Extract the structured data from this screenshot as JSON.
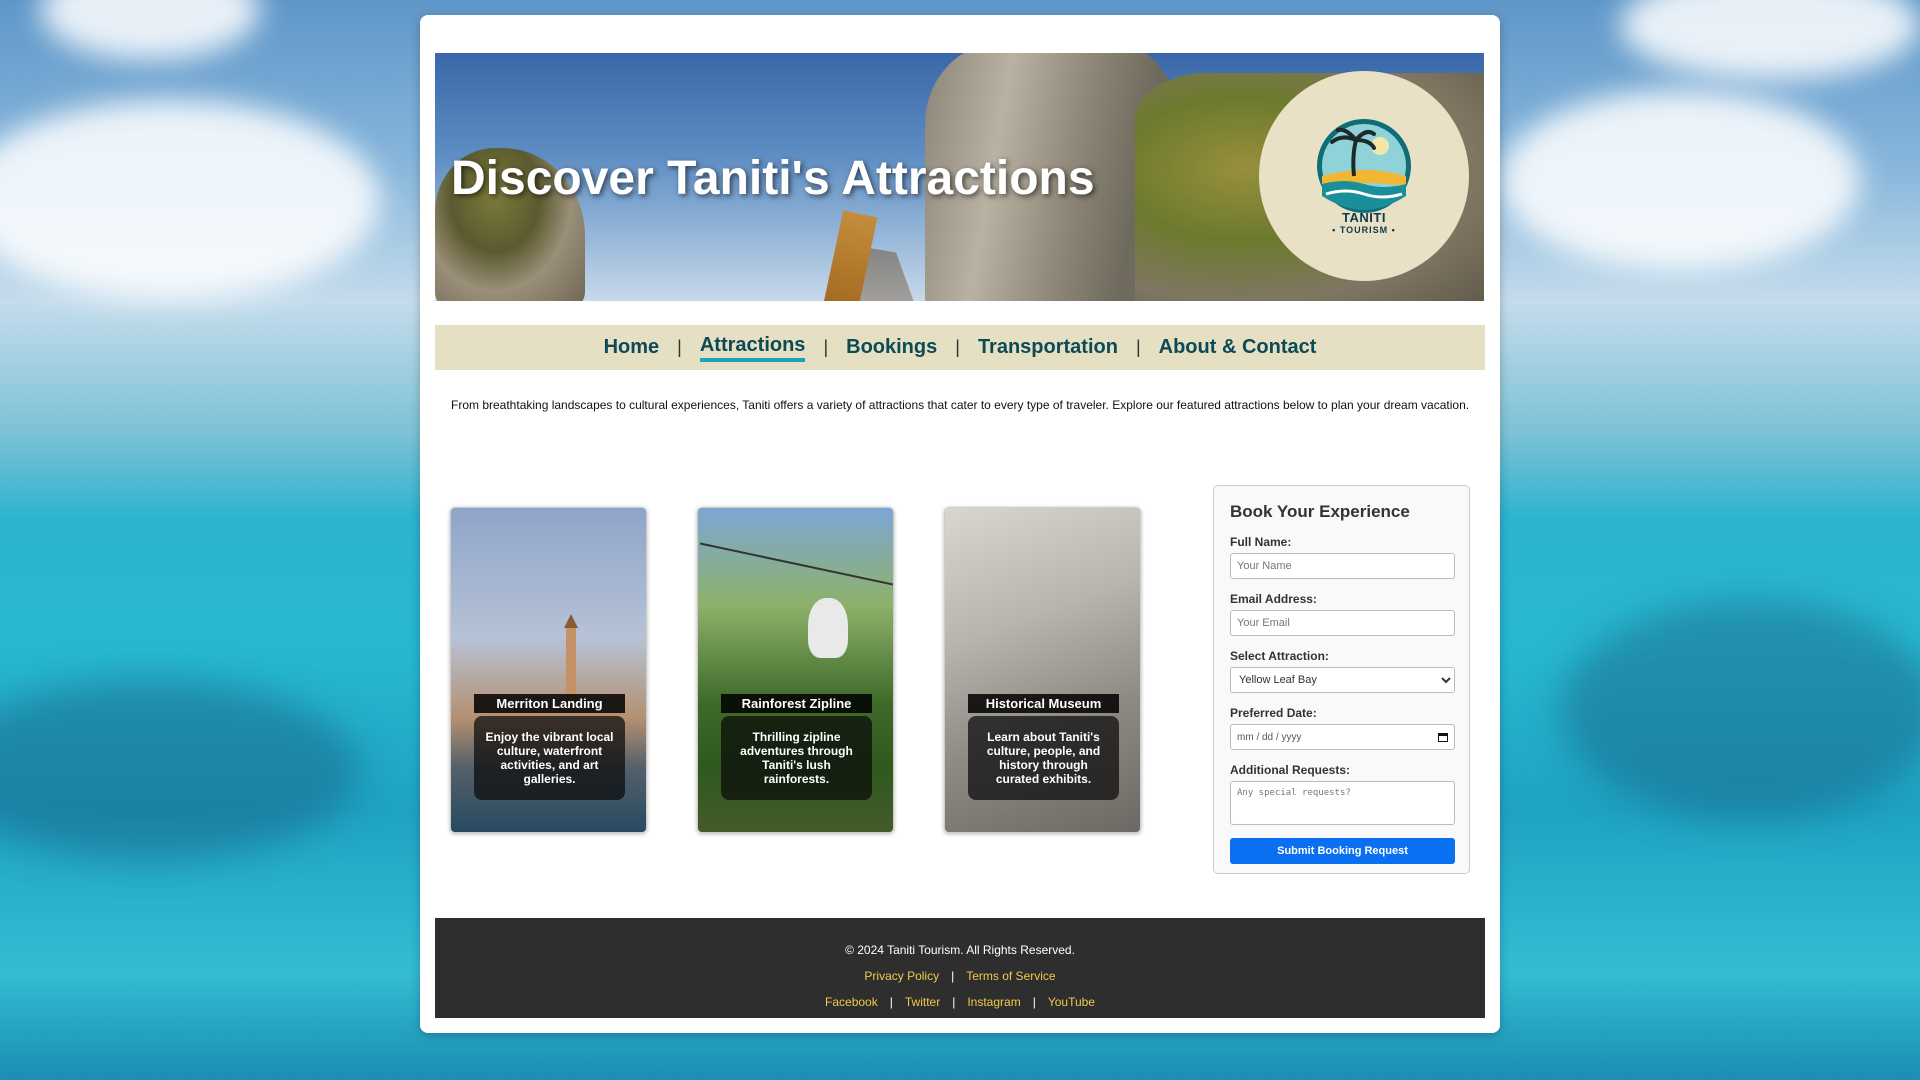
{
  "hero": {
    "title": "Discover Taniti's Attractions"
  },
  "logo": {
    "name": "TANITI",
    "sub": "• TOURISM •",
    "icon": "palm-island-logo-icon"
  },
  "nav": {
    "items": [
      {
        "label": "Home",
        "active": false
      },
      {
        "label": "Attractions",
        "active": true
      },
      {
        "label": "Bookings",
        "active": false
      },
      {
        "label": "Transportation",
        "active": false
      },
      {
        "label": "About & Contact",
        "active": false
      }
    ],
    "separator": "|"
  },
  "intro": "From breathtaking landscapes to cultural experiences, Taniti offers a variety of attractions that cater to every type of traveler. Explore our featured attractions below to plan your dream vacation.",
  "cards": [
    {
      "title": "Merriton Landing",
      "desc": "Enjoy the vibrant local culture, waterfront activities, and art galleries."
    },
    {
      "title": "Rainforest Zipline",
      "desc": "Thrilling zipline adventures through Taniti's lush rainforests."
    },
    {
      "title": "Historical Museum",
      "desc": "Learn about Taniti's culture, people, and history through curated exhibits."
    }
  ],
  "booking": {
    "heading": "Book Your Experience",
    "name_label": "Full Name:",
    "name_placeholder": "Your Name",
    "email_label": "Email Address:",
    "email_placeholder": "Your Email",
    "attraction_label": "Select Attraction:",
    "attraction_value": "Yellow Leaf Bay",
    "date_label": "Preferred Date:",
    "date_placeholder": "mm / dd / yyyy",
    "requests_label": "Additional Requests:",
    "requests_placeholder": "Any special requests?",
    "submit_label": "Submit Booking Request"
  },
  "footer": {
    "copyright": "© 2024 Taniti Tourism. All Rights Reserved.",
    "legal_links": [
      "Privacy Policy",
      "Terms of Service"
    ],
    "social_links": [
      "Facebook",
      "Twitter",
      "Instagram",
      "YouTube"
    ],
    "separator": "|"
  },
  "colors": {
    "nav_bg": "#e5dfc3",
    "nav_text": "#0d4a55",
    "nav_active_underline": "#1aa3b7",
    "submit_bg": "#0a6ff0",
    "footer_bg": "#2e2e2e",
    "footer_link": "#f2c94c"
  }
}
